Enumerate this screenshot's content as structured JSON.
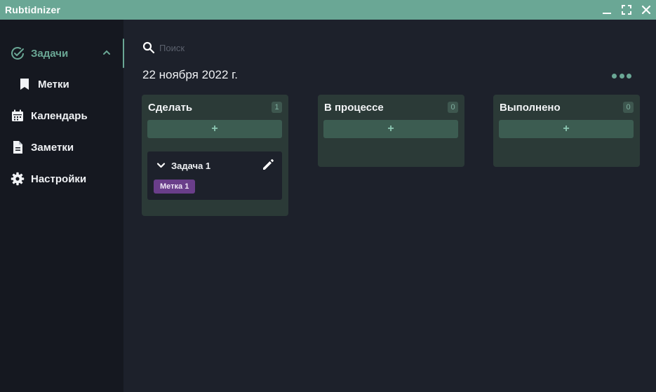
{
  "app": {
    "title": "Rubtidnizer"
  },
  "sidebar": {
    "items": [
      {
        "label": "Задачи",
        "icon": "check-circle-icon",
        "active": true
      },
      {
        "label": "Метки",
        "icon": "bookmark-icon"
      },
      {
        "label": "Календарь",
        "icon": "calendar-icon"
      },
      {
        "label": "Заметки",
        "icon": "document-icon"
      },
      {
        "label": "Настройки",
        "icon": "gear-icon"
      }
    ]
  },
  "search": {
    "placeholder": "Поиск",
    "value": ""
  },
  "main": {
    "date": "22 ноября 2022 г.",
    "columns": [
      {
        "title": "Сделать",
        "count": "1",
        "add_label": "+"
      },
      {
        "title": "В процессе",
        "count": "0",
        "add_label": "+"
      },
      {
        "title": "Выполнено",
        "count": "0",
        "add_label": "+"
      }
    ],
    "tasks": [
      {
        "title": "Задача 1",
        "tag": "Метка 1"
      }
    ]
  },
  "colors": {
    "accent": "#6aa795",
    "titlebar": "#6aa795",
    "sidebar_bg": "#151820",
    "main_bg": "#1d212b",
    "column_bg": "#2b3a37",
    "tag_bg": "#6a3e8a"
  }
}
